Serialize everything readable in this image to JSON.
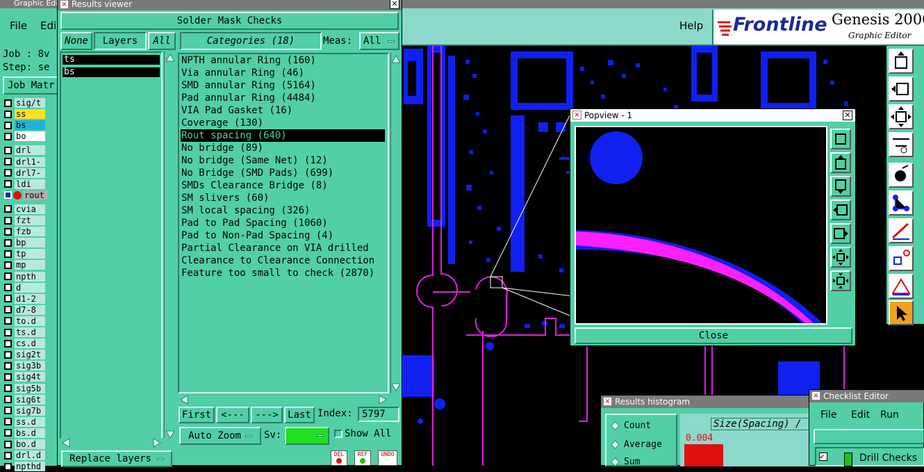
{
  "main_window": {
    "title": "Graphic Edit",
    "menu": {
      "file": "File",
      "edit": "Edi",
      "help": "Help"
    },
    "job_label": "Job : 8v",
    "step_label": "Step: se",
    "job_matrix": "Job Matr",
    "brand": {
      "name": "Frontline",
      "product": "Genesis 2000",
      "subtitle": "Graphic Editor"
    },
    "layers": [
      "sig/t",
      "ss",
      "bs",
      "bo",
      "drl",
      "drl1-",
      "drl7-",
      "ldi",
      "rout",
      "cvia",
      "fzt",
      "fzb",
      "bp",
      "tp",
      "mp",
      "npth",
      "d",
      "d1-2",
      "d7-8",
      "to.d",
      "ts.d",
      "cs.d",
      "sig2t",
      "sig3b",
      "sig4t",
      "sig5b",
      "sig6t",
      "sig7b",
      "ss.d",
      "bs.d",
      "bo.d",
      "drl.d",
      "npthd"
    ]
  },
  "results_viewer": {
    "title": "Results viewer",
    "header": "Solder Mask Checks",
    "none_label": "None",
    "layers_label": "Layers",
    "all_label": "All",
    "categories_label": "Categories (18)",
    "meas_label": "Meas:",
    "meas_value": "All",
    "layer_list": [
      "ts",
      "bs"
    ],
    "categories": [
      "NPTH annular Ring (160)",
      "Via annular Ring (46)",
      "SMD annular Ring (5164)",
      "Pad annular Ring (4484)",
      "VIA Pad Gasket (16)",
      "Coverage (130)",
      "Rout spacing (640)",
      "No bridge (89)",
      "No bridge (Same Net) (12)",
      "No Bridge (SMD Pads) (699)",
      "SMDs Clearance Bridge (8)",
      "SM slivers (60)",
      "SM local spacing (326)",
      "Pad to Pad Spacing (1060)",
      "Pad to Non-Pad Spacing (4)",
      "Partial Clearance on VIA drilled",
      "Clearance to Clearance Connection",
      "Feature too small to check (2870)"
    ],
    "selected_index": 6,
    "nav": {
      "first": "First",
      "prev": "<---",
      "next": "--->",
      "last": "Last",
      "index_label": "Index:",
      "index_value": "5797"
    },
    "auto_zoom": "Auto Zoom",
    "sv_label": "Sv:",
    "show_all": "Show All",
    "replace_layers": "Replace layers",
    "icons": {
      "del": "DEL",
      "ref": "REF",
      "undo": "UNDO"
    }
  },
  "popview": {
    "title": "Popview - 1",
    "close_label": "Close"
  },
  "histogram": {
    "title": "Results histogram",
    "options": [
      "Count",
      "Average",
      "Sum"
    ],
    "axis_label": "Size(Spacing) /",
    "value": "0.004"
  },
  "checklist": {
    "title": "Checklist Editor",
    "menu": [
      "File",
      "Edit",
      "Run"
    ],
    "item": "Drill Checks"
  },
  "colors": {
    "teal": "#52cfa7",
    "canvas": "#000000",
    "copper": "#1020f0",
    "rout": "#e020e0",
    "brand_red": "#e01010",
    "brand_blue": "#1a2a9a"
  }
}
